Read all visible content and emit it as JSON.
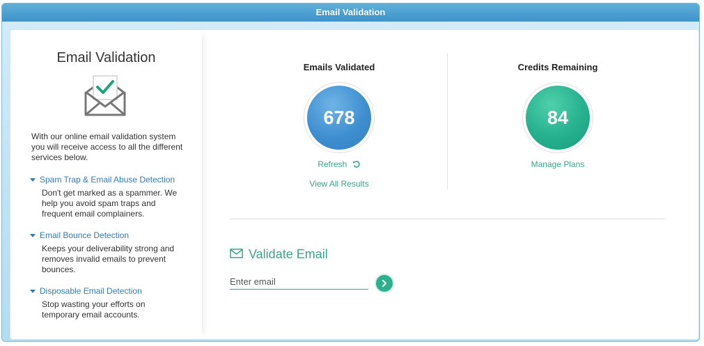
{
  "window": {
    "title": "Email Validation"
  },
  "sidebar": {
    "title": "Email Validation",
    "intro": "With our online email validation system you will receive access to all the different services below.",
    "features": [
      {
        "title": "Spam Trap & Email Abuse Detection",
        "desc": "Don't get marked as a spammer. We help you avoid spam traps and frequent email complainers."
      },
      {
        "title": "Email Bounce Detection",
        "desc": "Keeps your deliverability strong and removes invalid emails to prevent bounces."
      },
      {
        "title": "Disposable Email Detection",
        "desc": "Stop wasting your efforts on temporary email accounts."
      }
    ]
  },
  "stats": {
    "validated": {
      "title": "Emails Validated",
      "value": "678",
      "refresh_label": "Refresh",
      "view_all_label": "View All Results"
    },
    "credits": {
      "title": "Credits Remaining",
      "value": "84",
      "manage_label": "Manage Plans"
    }
  },
  "validate": {
    "title": "Validate Email",
    "input_placeholder": "Enter email",
    "input_value": ""
  },
  "colors": {
    "accent_green": "#3aa489",
    "link_blue": "#2e7db5",
    "circle_blue": "#3f8fd0",
    "circle_green": "#26b08e",
    "titlebar": "#3d93c7"
  },
  "icons": {
    "envelope_check": "envelope-check-icon",
    "refresh": "refresh-icon",
    "envelope": "envelope-icon",
    "go": "chevron-right-icon",
    "caret": "caret-down-icon"
  }
}
